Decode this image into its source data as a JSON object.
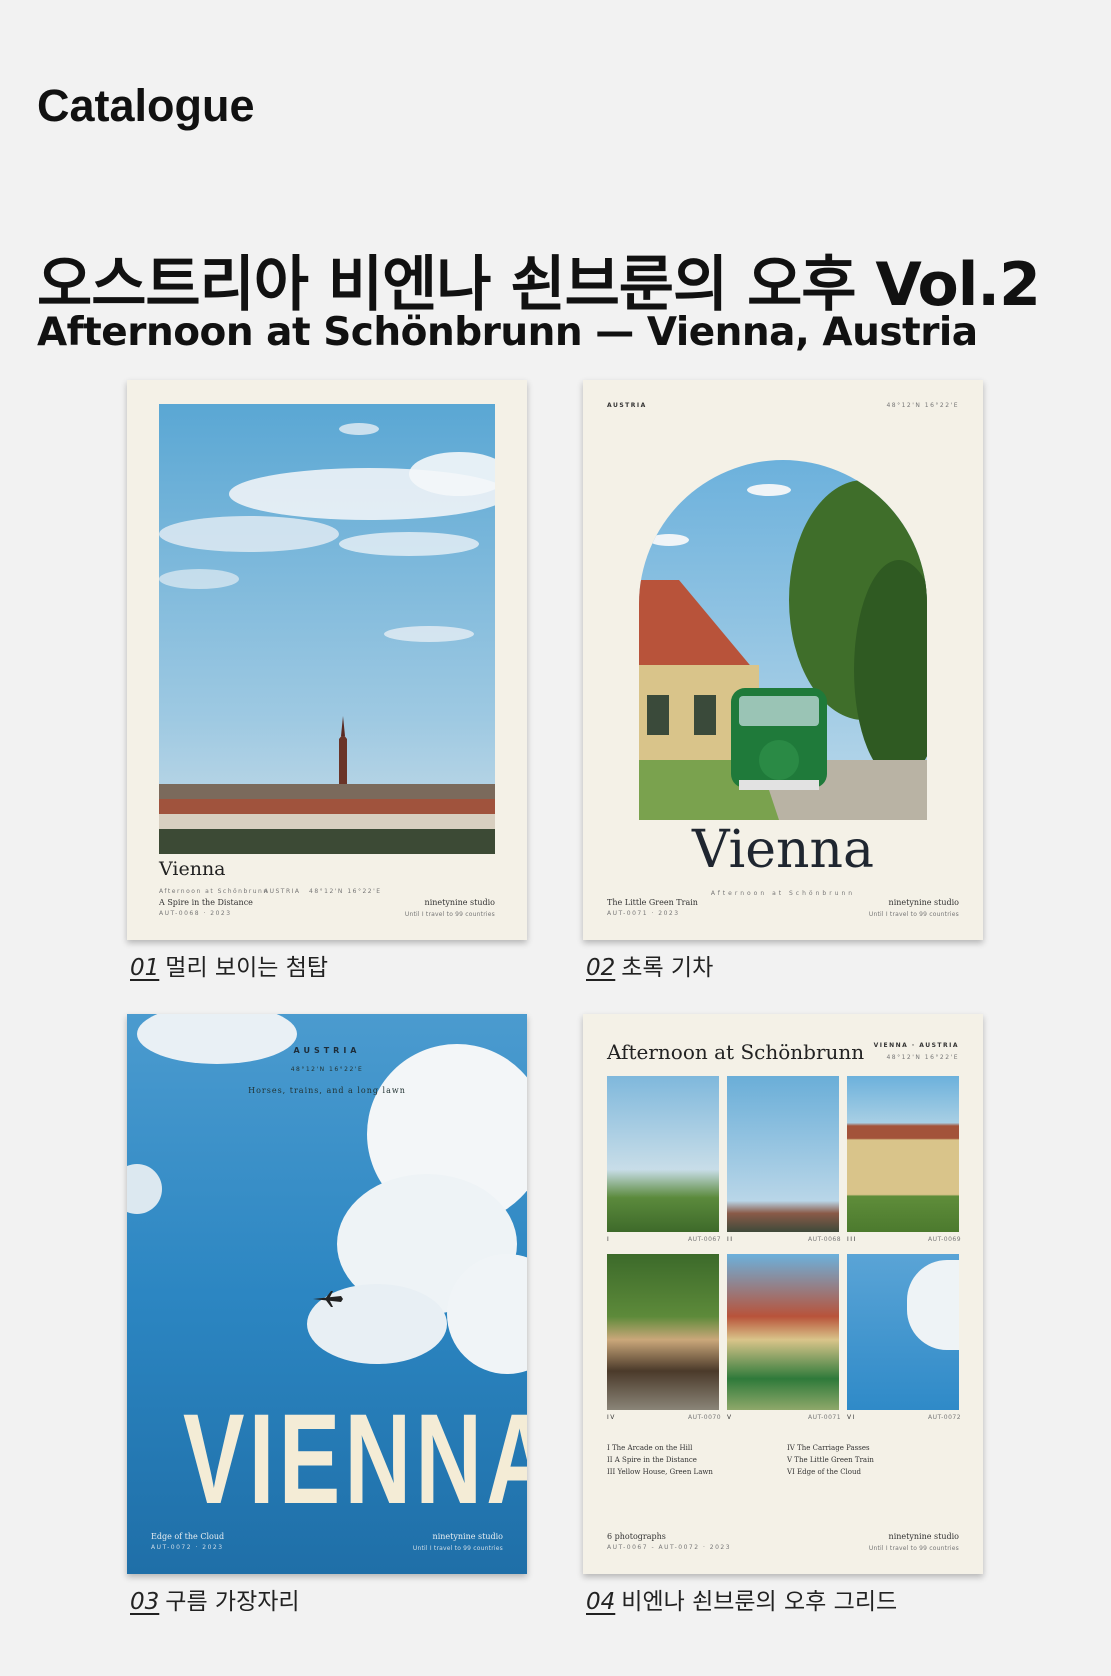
{
  "header": {
    "label": "Catalogue"
  },
  "title": {
    "korean": "오스트리아 비엔나 쇤브룬의 오후 Vol.2",
    "english": "Afternoon at Schönbrunn — Vienna, Austria"
  },
  "posters": [
    {
      "num": "01",
      "caption": "멀리 보이는 첨탑",
      "title": "Vienna",
      "meta": [
        "Afternoon at Schönbrunn",
        "AUSTRIA",
        "48°12'N 16°22'E"
      ],
      "subtitle": "A Spire in the Distance",
      "code": "AUT-0068 · 2023",
      "studio": "ninetynine studio",
      "studio_tag": "Until I travel to 99 countries"
    },
    {
      "num": "02",
      "caption": "초록 기차",
      "country": "AUSTRIA",
      "coords": "48°12'N 16°22'E",
      "title": "Vienna",
      "tagline": "Afternoon at Schönbrunn",
      "subtitle": "The Little Green Train",
      "code": "AUT-0071 · 2023",
      "studio": "ninetynine studio",
      "studio_tag": "Until I travel to 99 countries"
    },
    {
      "num": "03",
      "caption": "구름 가장자리",
      "country": "AUSTRIA",
      "coords": "48°12'N 16°22'E",
      "tagline": "Horses, trains, and a long lawn",
      "title": "VIENNA",
      "subtitle": "Edge of the Cloud",
      "code": "AUT-0072 · 2023",
      "studio": "ninetynine studio",
      "studio_tag": "Until I travel to 99 countries"
    },
    {
      "num": "04",
      "caption": "비엔나 쇤브룬의 오후 그리드",
      "title": "Afternoon at Schönbrunn",
      "location": "VIENNA · AUSTRIA",
      "coords": "48°12'N 16°22'E",
      "tiles": [
        {
          "roman": "I",
          "code": "AUT-0067"
        },
        {
          "roman": "II",
          "code": "AUT-0068"
        },
        {
          "roman": "III",
          "code": "AUT-0069"
        },
        {
          "roman": "IV",
          "code": "AUT-0070"
        },
        {
          "roman": "V",
          "code": "AUT-0071"
        },
        {
          "roman": "VI",
          "code": "AUT-0072"
        }
      ],
      "list_left": [
        "I  The Arcade on the Hill",
        "II  A Spire in the Distance",
        "III  Yellow House, Green Lawn"
      ],
      "list_right": [
        "IV  The Carriage Passes",
        "V  The Little Green Train",
        "VI  Edge of the Cloud"
      ],
      "count": "6 photographs",
      "code": "AUT-0067 - AUT-0072 · 2023",
      "studio": "ninetynine studio",
      "studio_tag": "Until I travel to 99 countries"
    }
  ]
}
